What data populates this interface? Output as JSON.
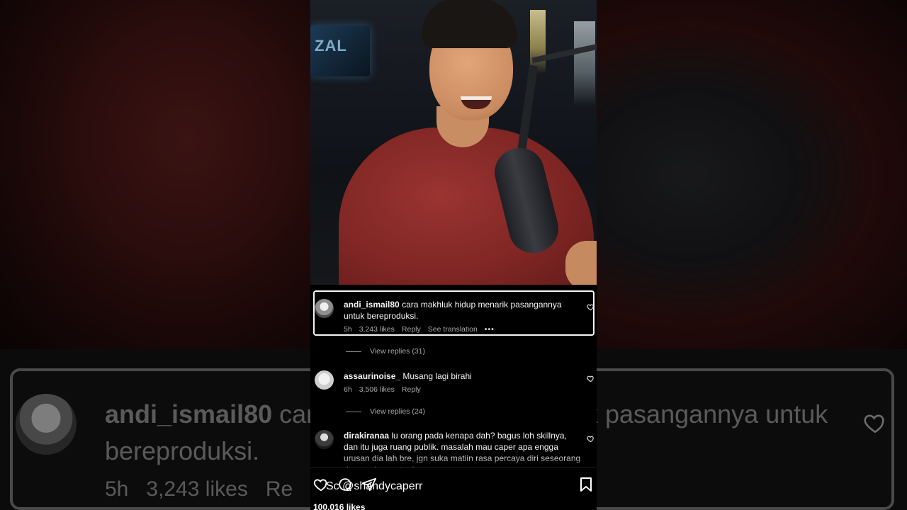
{
  "comments": [
    {
      "username": "andi_ismail80",
      "text": "cara makhluk hidup menarik pasangannya untuk bereproduksi.",
      "age": "5h",
      "likes": "3,243 likes",
      "reply": "Reply",
      "translate": "See translation",
      "more": "•••",
      "view_replies": "View replies (31)"
    },
    {
      "username": "assaurinoise_",
      "text": "Musang lagi birahi",
      "age": "6h",
      "likes": "3,506 likes",
      "reply": "Reply",
      "view_replies": "View replies (24)"
    },
    {
      "username": "dirakiranaa",
      "text": "lu orang pada kenapa dah? bagus loh skillnya, dan itu juga ruang publik. masalah mau caper apa engga urusan dia lah bre, jgn suka matiin rasa percaya diri seseorang dengan komentar lu"
    }
  ],
  "zoom": {
    "username": "andi_ismail80",
    "text_line1": "car",
    "text_line1_right": "k pasangannya untuk",
    "text_line2": "bereproduksi.",
    "age": "5h",
    "likes": "3,243 likes",
    "reply": "Re"
  },
  "video": {
    "sign_text": "ZAL"
  },
  "action_bar": {
    "watermark": "Sc @shandycaperr",
    "likes_count": "100,016 likes"
  },
  "icons": {
    "heart": "heart-icon",
    "comment": "comment-icon",
    "share": "send-icon",
    "save": "bookmark-icon"
  },
  "colors": {
    "background": "#000000",
    "text": "#f5f5f5",
    "meta": "#a8a8a8",
    "shirt": "#7f2624"
  }
}
